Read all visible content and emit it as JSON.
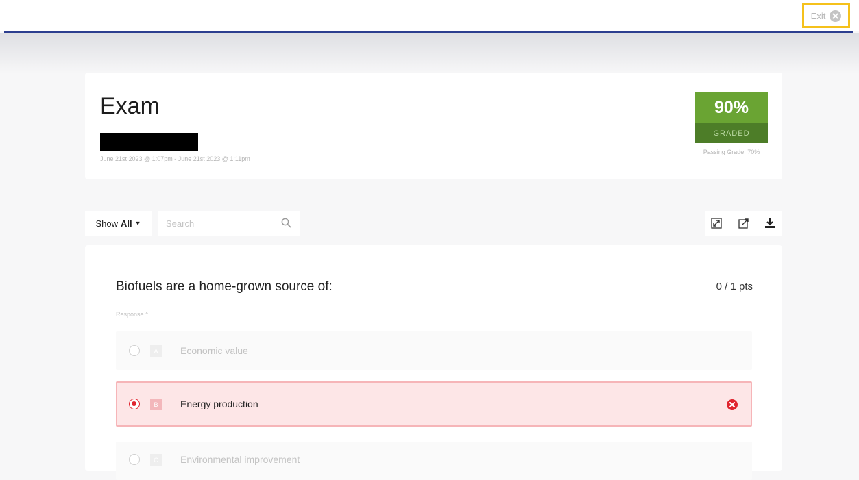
{
  "topbar": {
    "exit_label": "Exit",
    "accent_color": "#2c3e8f",
    "exit_highlight_color": "#f5c11b"
  },
  "exam": {
    "title": "Exam",
    "date_range": "June 21st 2023 @ 1:07pm - June 21st 2023 @ 1:11pm",
    "score": "90%",
    "status": "GRADED",
    "passing_grade": "Passing Grade: 70%",
    "score_color": "#6aa433"
  },
  "filters": {
    "show_label": "Show",
    "show_value": "All",
    "search_placeholder": "Search"
  },
  "tools": {
    "icons": [
      "expand-icon",
      "collapse-icon",
      "download-icon"
    ]
  },
  "question": {
    "text": "Biofuels are a home-grown source of:",
    "points": "0 / 1 pts",
    "response_label": "Response ^",
    "options": [
      {
        "letter": "A",
        "text": "Economic value",
        "selected": false
      },
      {
        "letter": "B",
        "text": "Energy production",
        "selected": true,
        "incorrect": true
      },
      {
        "letter": "C",
        "text": "Environmental improvement",
        "selected": false
      }
    ],
    "incorrect_color": "#e0252f"
  }
}
